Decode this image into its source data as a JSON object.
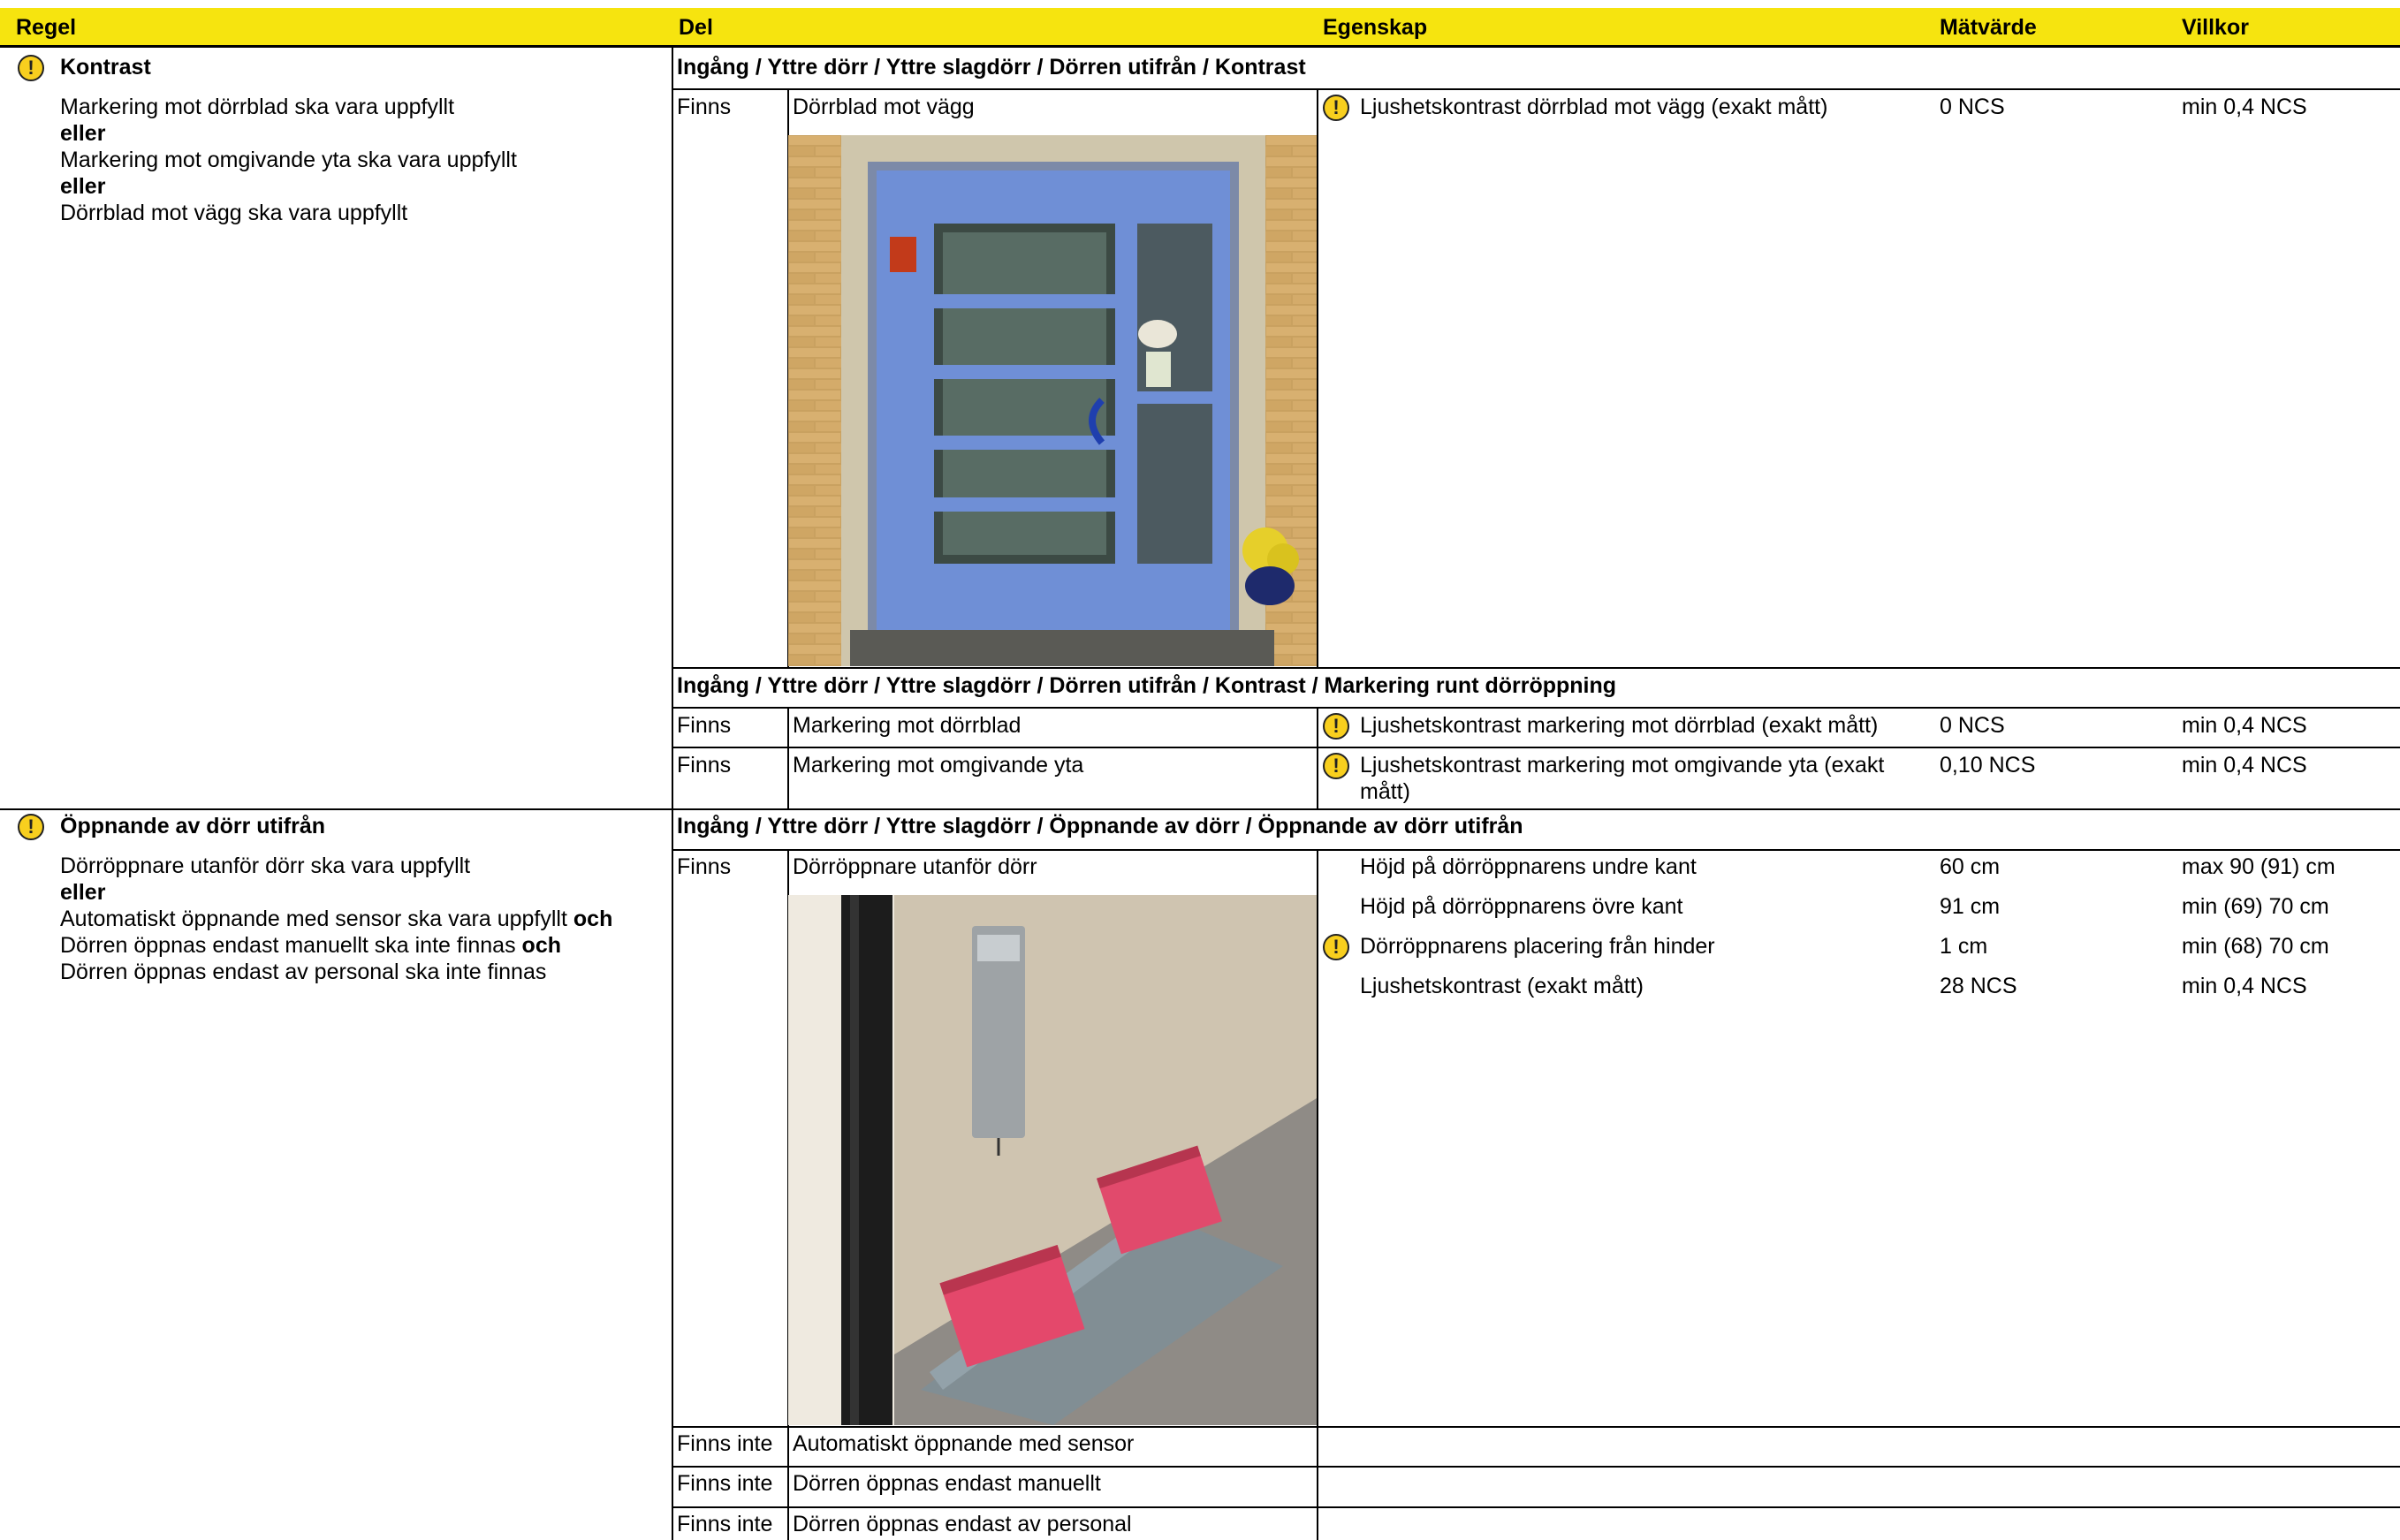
{
  "header": {
    "regel": "Regel",
    "del": "Del",
    "egenskap": "Egenskap",
    "matvarde": "Mätvärde",
    "villkor": "Villkor"
  },
  "rules": [
    {
      "title": "Kontrast",
      "lines": [
        "Markering mot dörrblad ska vara uppfyllt",
        "eller",
        "Markering mot omgivande yta ska vara uppfyllt",
        "eller",
        "Dörrblad mot vägg ska vara uppfyllt"
      ]
    },
    {
      "title": "Öppnande av dörr utifrån",
      "lines": [
        "Dörröppnare utanför dörr ska vara uppfyllt",
        "eller",
        "Automatiskt öppnande med sensor ska vara uppfyllt",
        "och",
        "Dörren öppnas endast manuellt ska inte finnas",
        "och",
        "Dörren öppnas endast av personal ska inte finnas"
      ]
    }
  ],
  "sections": [
    {
      "path": "Ingång / Yttre dörr / Yttre slagdörr  / Dörren utifrån / Kontrast",
      "rows": [
        {
          "status": "Finns",
          "part": "Dörrblad mot vägg",
          "props": [
            {
              "name": "Ljushetskontrast dörrblad mot vägg (exakt mått)",
              "value": "0 NCS",
              "cond": "min 0,4 NCS",
              "warn": true
            }
          ]
        }
      ]
    },
    {
      "path": "Ingång / Yttre dörr / Yttre slagdörr  / Dörren utifrån / Kontrast / Markering runt dörröppning",
      "rows": [
        {
          "status": "Finns",
          "part": "Markering mot dörrblad",
          "props": [
            {
              "name": "Ljushetskontrast markering mot dörrblad (exakt mått)",
              "value": "0 NCS",
              "cond": "min 0,4 NCS",
              "warn": true
            }
          ]
        },
        {
          "status": "Finns",
          "part": "Markering mot omgivande yta",
          "props": [
            {
              "name": "Ljushetskontrast markering mot omgivande yta (exakt mått)",
              "value": "0,10 NCS",
              "cond": "min 0,4 NCS",
              "warn": true
            }
          ]
        }
      ]
    },
    {
      "path": "Ingång / Yttre dörr / Yttre slagdörr  / Öppnande av dörr / Öppnande av dörr utifrån",
      "rows": [
        {
          "status": "Finns",
          "part": "Dörröppnare utanför dörr",
          "props": [
            {
              "name": "Höjd på dörröppnarens undre kant",
              "value": "60 cm",
              "cond": "max 90 (91) cm",
              "warn": false
            },
            {
              "name": "Höjd på dörröppnarens övre kant",
              "value": "91 cm",
              "cond": "min (69) 70 cm",
              "warn": false
            },
            {
              "name": "Dörröppnarens placering från hinder",
              "value": "1 cm",
              "cond": "min (68) 70 cm",
              "warn": true
            },
            {
              "name": "Ljushetskontrast (exakt mått)",
              "value": "28 NCS",
              "cond": "min 0,4 NCS",
              "warn": false
            }
          ]
        },
        {
          "status": "Finns inte",
          "part": "Automatiskt öppnande med sensor",
          "props": []
        },
        {
          "status": "Finns inte",
          "part": "Dörren öppnas endast manuellt",
          "props": []
        },
        {
          "status": "Finns inte",
          "part": "Dörren öppnas endast av personal",
          "props": []
        }
      ]
    }
  ],
  "icons": {
    "warning": "warning-icon"
  },
  "colors": {
    "header_bg": "#f6e40f",
    "warning": "#f8cf1e"
  }
}
